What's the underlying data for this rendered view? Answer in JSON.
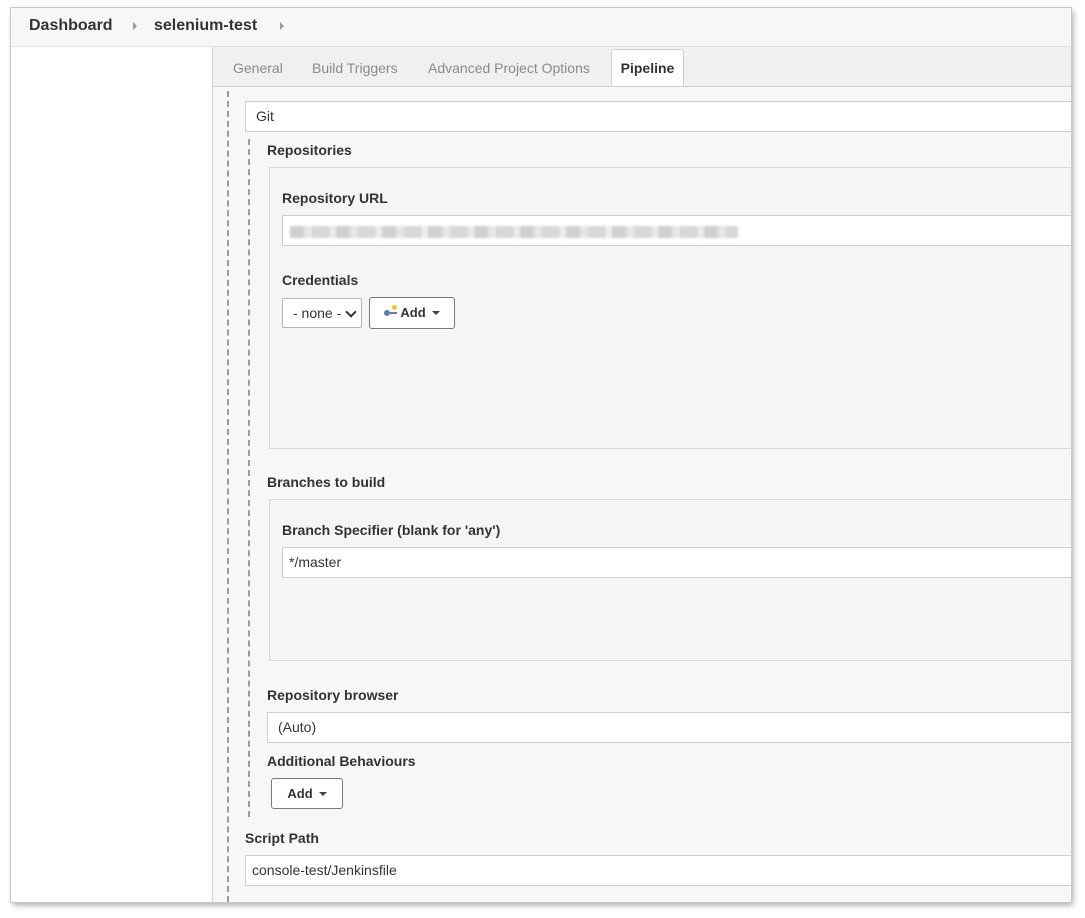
{
  "breadcrumb": {
    "items": [
      "Dashboard",
      "selenium-test"
    ]
  },
  "tabs": [
    {
      "label": "General",
      "active": false
    },
    {
      "label": "Build Triggers",
      "active": false
    },
    {
      "label": "Advanced Project Options",
      "active": false
    },
    {
      "label": "Pipeline",
      "active": true
    }
  ],
  "scm": {
    "value": "Git"
  },
  "repositories": {
    "section_label": "Repositories",
    "url_label": "Repository URL",
    "credentials_label": "Credentials",
    "credentials_selected": "- none -",
    "add_label": "Add"
  },
  "branches": {
    "section_label": "Branches to build",
    "specifier_label": "Branch Specifier (blank for 'any')",
    "specifier_value": "*/master"
  },
  "repo_browser": {
    "label": "Repository browser",
    "value": "(Auto)"
  },
  "behaviours": {
    "label": "Additional Behaviours",
    "add_label": "Add"
  },
  "script_path": {
    "label": "Script Path",
    "value": "console-test/Jenkinsfile"
  },
  "colors": {
    "background": "#f7f7f7",
    "border": "#cfcfcf",
    "text": "#333333",
    "tab_inactive": "#8a8a8a",
    "key_icon": "#5b7fb0"
  }
}
